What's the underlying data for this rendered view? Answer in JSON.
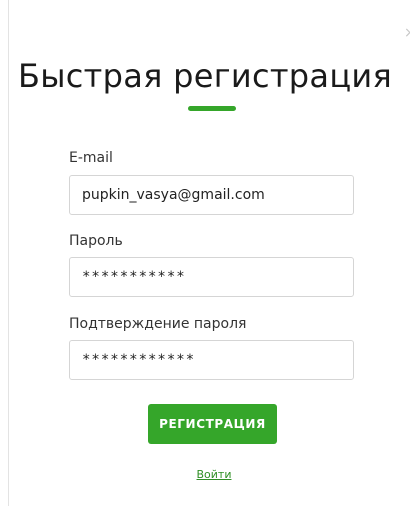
{
  "modal": {
    "close_icon": "×",
    "title": "Быстрая регистрация",
    "accent_color": "#35a62a"
  },
  "form": {
    "email": {
      "label": "E-mail",
      "value": "pupkin_vasya@gmail.com"
    },
    "password": {
      "label": "Пароль",
      "value": "***********"
    },
    "password_confirm": {
      "label": "Подтверждение пароля",
      "value": "************"
    },
    "submit_label": "РЕГИСТРАЦИЯ",
    "login_link": "Войти"
  }
}
